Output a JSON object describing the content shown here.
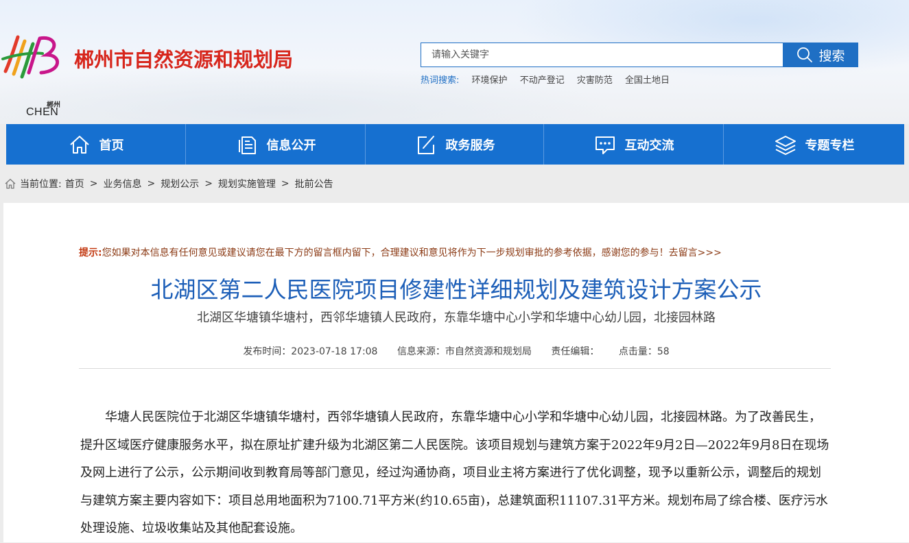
{
  "site": {
    "logo_cn": "郴州",
    "logo_en": "CHEN",
    "title": "郴州市自然资源和规划局"
  },
  "search": {
    "placeholder": "请输入关键字",
    "button_label": "搜索",
    "hot_label": "热词搜索:",
    "hot_words": [
      "环境保护",
      "不动产登记",
      "灾害防范",
      "全国土地日"
    ]
  },
  "nav": {
    "items": [
      {
        "label": "首页",
        "icon": "home-icon"
      },
      {
        "label": "信息公开",
        "icon": "document-icon"
      },
      {
        "label": "政务服务",
        "icon": "edit-icon"
      },
      {
        "label": "互动交流",
        "icon": "chat-icon"
      },
      {
        "label": "专题专栏",
        "icon": "layers-icon"
      }
    ]
  },
  "breadcrumb": {
    "prefix": "当前位置:",
    "items": [
      "首页",
      "业务信息",
      "规划公示",
      "规划实施管理",
      "批前公告"
    ],
    "separator": ">"
  },
  "article": {
    "tip_label": "提示:",
    "tip_text": "您如果对本信息有任何意见或建议请您在最下方的留言框内留下，合理建议和意见将作为下一步规划审批的参考依据，感谢您的参与！",
    "tip_link": "去留言>>>",
    "title": "北湖区第二人民医院项目修建性详细规划及建筑设计方案公示",
    "subtitle": "北湖区华塘镇华塘村，西邻华塘镇人民政府，东靠华塘中心小学和华塘中心幼儿园，北接园林路",
    "meta": {
      "publish_time": "发布时间：2023-07-18 17:08",
      "source": "信息来源：市自然资源和规划局",
      "editor": "责任编辑：",
      "clicks": "点击量：58"
    },
    "body": "华塘人民医院位于北湖区华塘镇华塘村，西邻华塘镇人民政府，东靠华塘中心小学和华塘中心幼儿园，北接园林路。为了改善民生，提升区域医疗健康服务水平，拟在原址扩建升级为北湖区第二人民医院。该项目规划与建筑方案于2022年9月2日—2022年9月8日在现场及网上进行了公示，公示期间收到教育局等部门意见，经过沟通协商，项目业主将方案进行了优化调整，现予以重新公示，调整后的规划与建筑方案主要内容如下：项目总用地面积为7100.71平方米(约10.65亩)，总建筑面积11107.31平方米。规划布局了综合楼、医疗污水处理设施、垃圾收集站及其他配套设施。"
  },
  "colors": {
    "brand_red": "#d7261c",
    "nav_blue": "#1670d0",
    "title_blue": "#1d5fb8",
    "tip_brown": "#8b3a14"
  }
}
